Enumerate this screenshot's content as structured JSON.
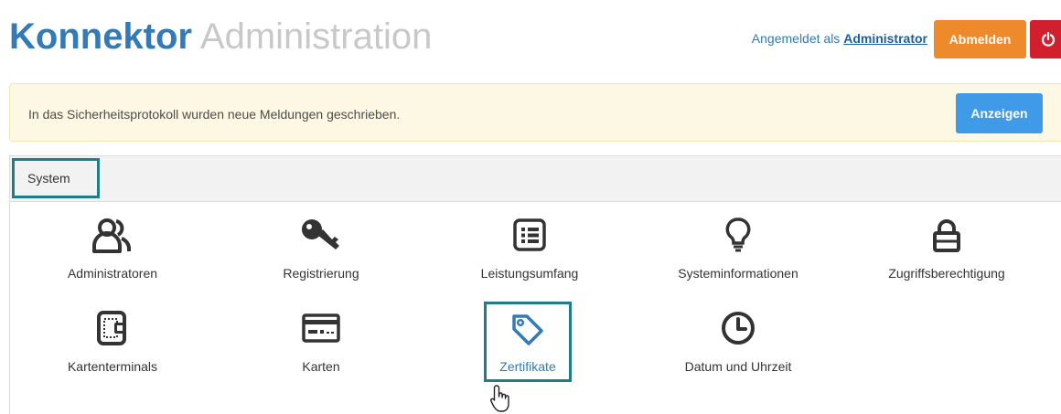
{
  "header": {
    "brand_strong": "Konnektor",
    "brand_light": "Administration",
    "login_prefix": "Angemeldet als",
    "login_user": "Administrator",
    "logout_label": "Abmelden",
    "power_icon": "power-icon"
  },
  "alert": {
    "message": "In das Sicherheitsprotokoll wurden neue Meldungen geschrieben.",
    "button_label": "Anzeigen"
  },
  "panel": {
    "tab_label": "System",
    "tiles": [
      {
        "label": "Administratoren",
        "icon": "users-icon"
      },
      {
        "label": "Registrierung",
        "icon": "key-icon"
      },
      {
        "label": "Leistungsumfang",
        "icon": "list-icon"
      },
      {
        "label": "Systeminformationen",
        "icon": "lightbulb-icon"
      },
      {
        "label": "Zugriffsberechtigung",
        "icon": "lock-icon"
      },
      {
        "label": "Kartenterminals",
        "icon": "card-terminal-icon"
      },
      {
        "label": "Karten",
        "icon": "card-icon"
      },
      {
        "label": "Zertifikate",
        "icon": "tag-icon"
      },
      {
        "label": "Datum und Uhrzeit",
        "icon": "clock-icon"
      }
    ]
  },
  "colors": {
    "brand": "#337ab7",
    "logout": "#ef8a2c",
    "power": "#d11f2e",
    "alert_bg": "#fcf8e3",
    "show_button": "#3f9ae8",
    "highlight_border": "#1f7d8a"
  }
}
